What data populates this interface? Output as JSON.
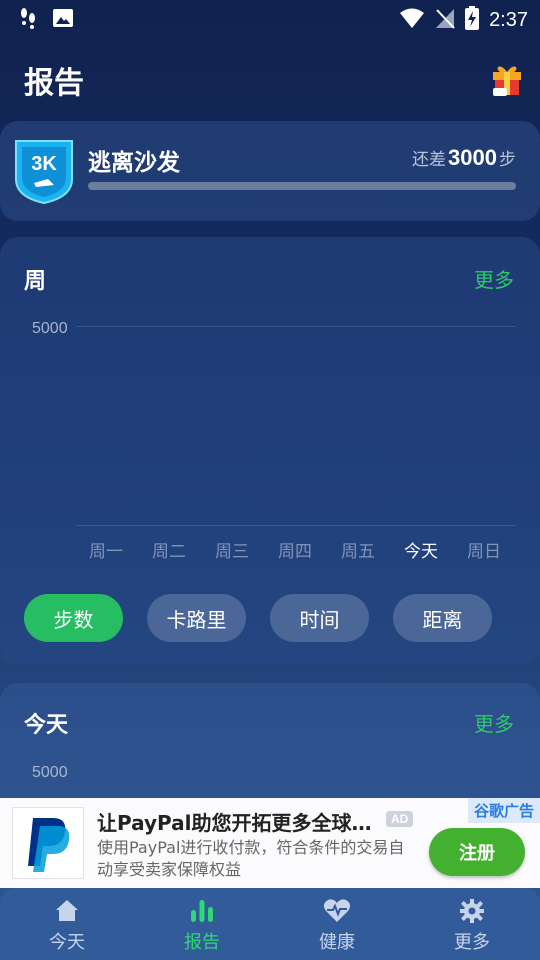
{
  "status_bar": {
    "time": "2:37"
  },
  "header": {
    "title": "报告"
  },
  "goal": {
    "badge_text": "3K",
    "name": "逃离沙发",
    "remaining_prefix": "还差",
    "remaining_steps": "3000",
    "remaining_unit": "步",
    "progress": 0
  },
  "weekly": {
    "title": "周",
    "more_label": "更多",
    "y_axis_label": "5000",
    "days": [
      "周一",
      "周二",
      "周三",
      "周四",
      "周五",
      "今天",
      "周日"
    ],
    "today_index": 5,
    "metric_tabs": [
      {
        "label": "步数",
        "active": true
      },
      {
        "label": "卡路里",
        "active": false
      },
      {
        "label": "时间",
        "active": false
      },
      {
        "label": "距离",
        "active": false
      }
    ]
  },
  "today": {
    "title": "今天",
    "more_label": "更多",
    "y_axis_label": "5000"
  },
  "ad": {
    "title": "让PayPal助您开拓更多全球…",
    "description": "使用PayPal进行收付款，符合条件的交易自动享受卖家保障权益",
    "tag": "AD",
    "brand": "谷歌广告",
    "cta_label": "注册"
  },
  "bottom_nav": {
    "items": [
      {
        "label": "今天",
        "icon": "home-icon",
        "active": false
      },
      {
        "label": "报告",
        "icon": "bar-chart-icon",
        "active": true
      },
      {
        "label": "健康",
        "icon": "heart-pulse-icon",
        "active": false
      },
      {
        "label": "更多",
        "icon": "gear-icon",
        "active": false
      }
    ]
  },
  "colors": {
    "accent_green": "#27bd63",
    "tab_inactive": "#4a6797",
    "more_link": "#2fc76d"
  }
}
